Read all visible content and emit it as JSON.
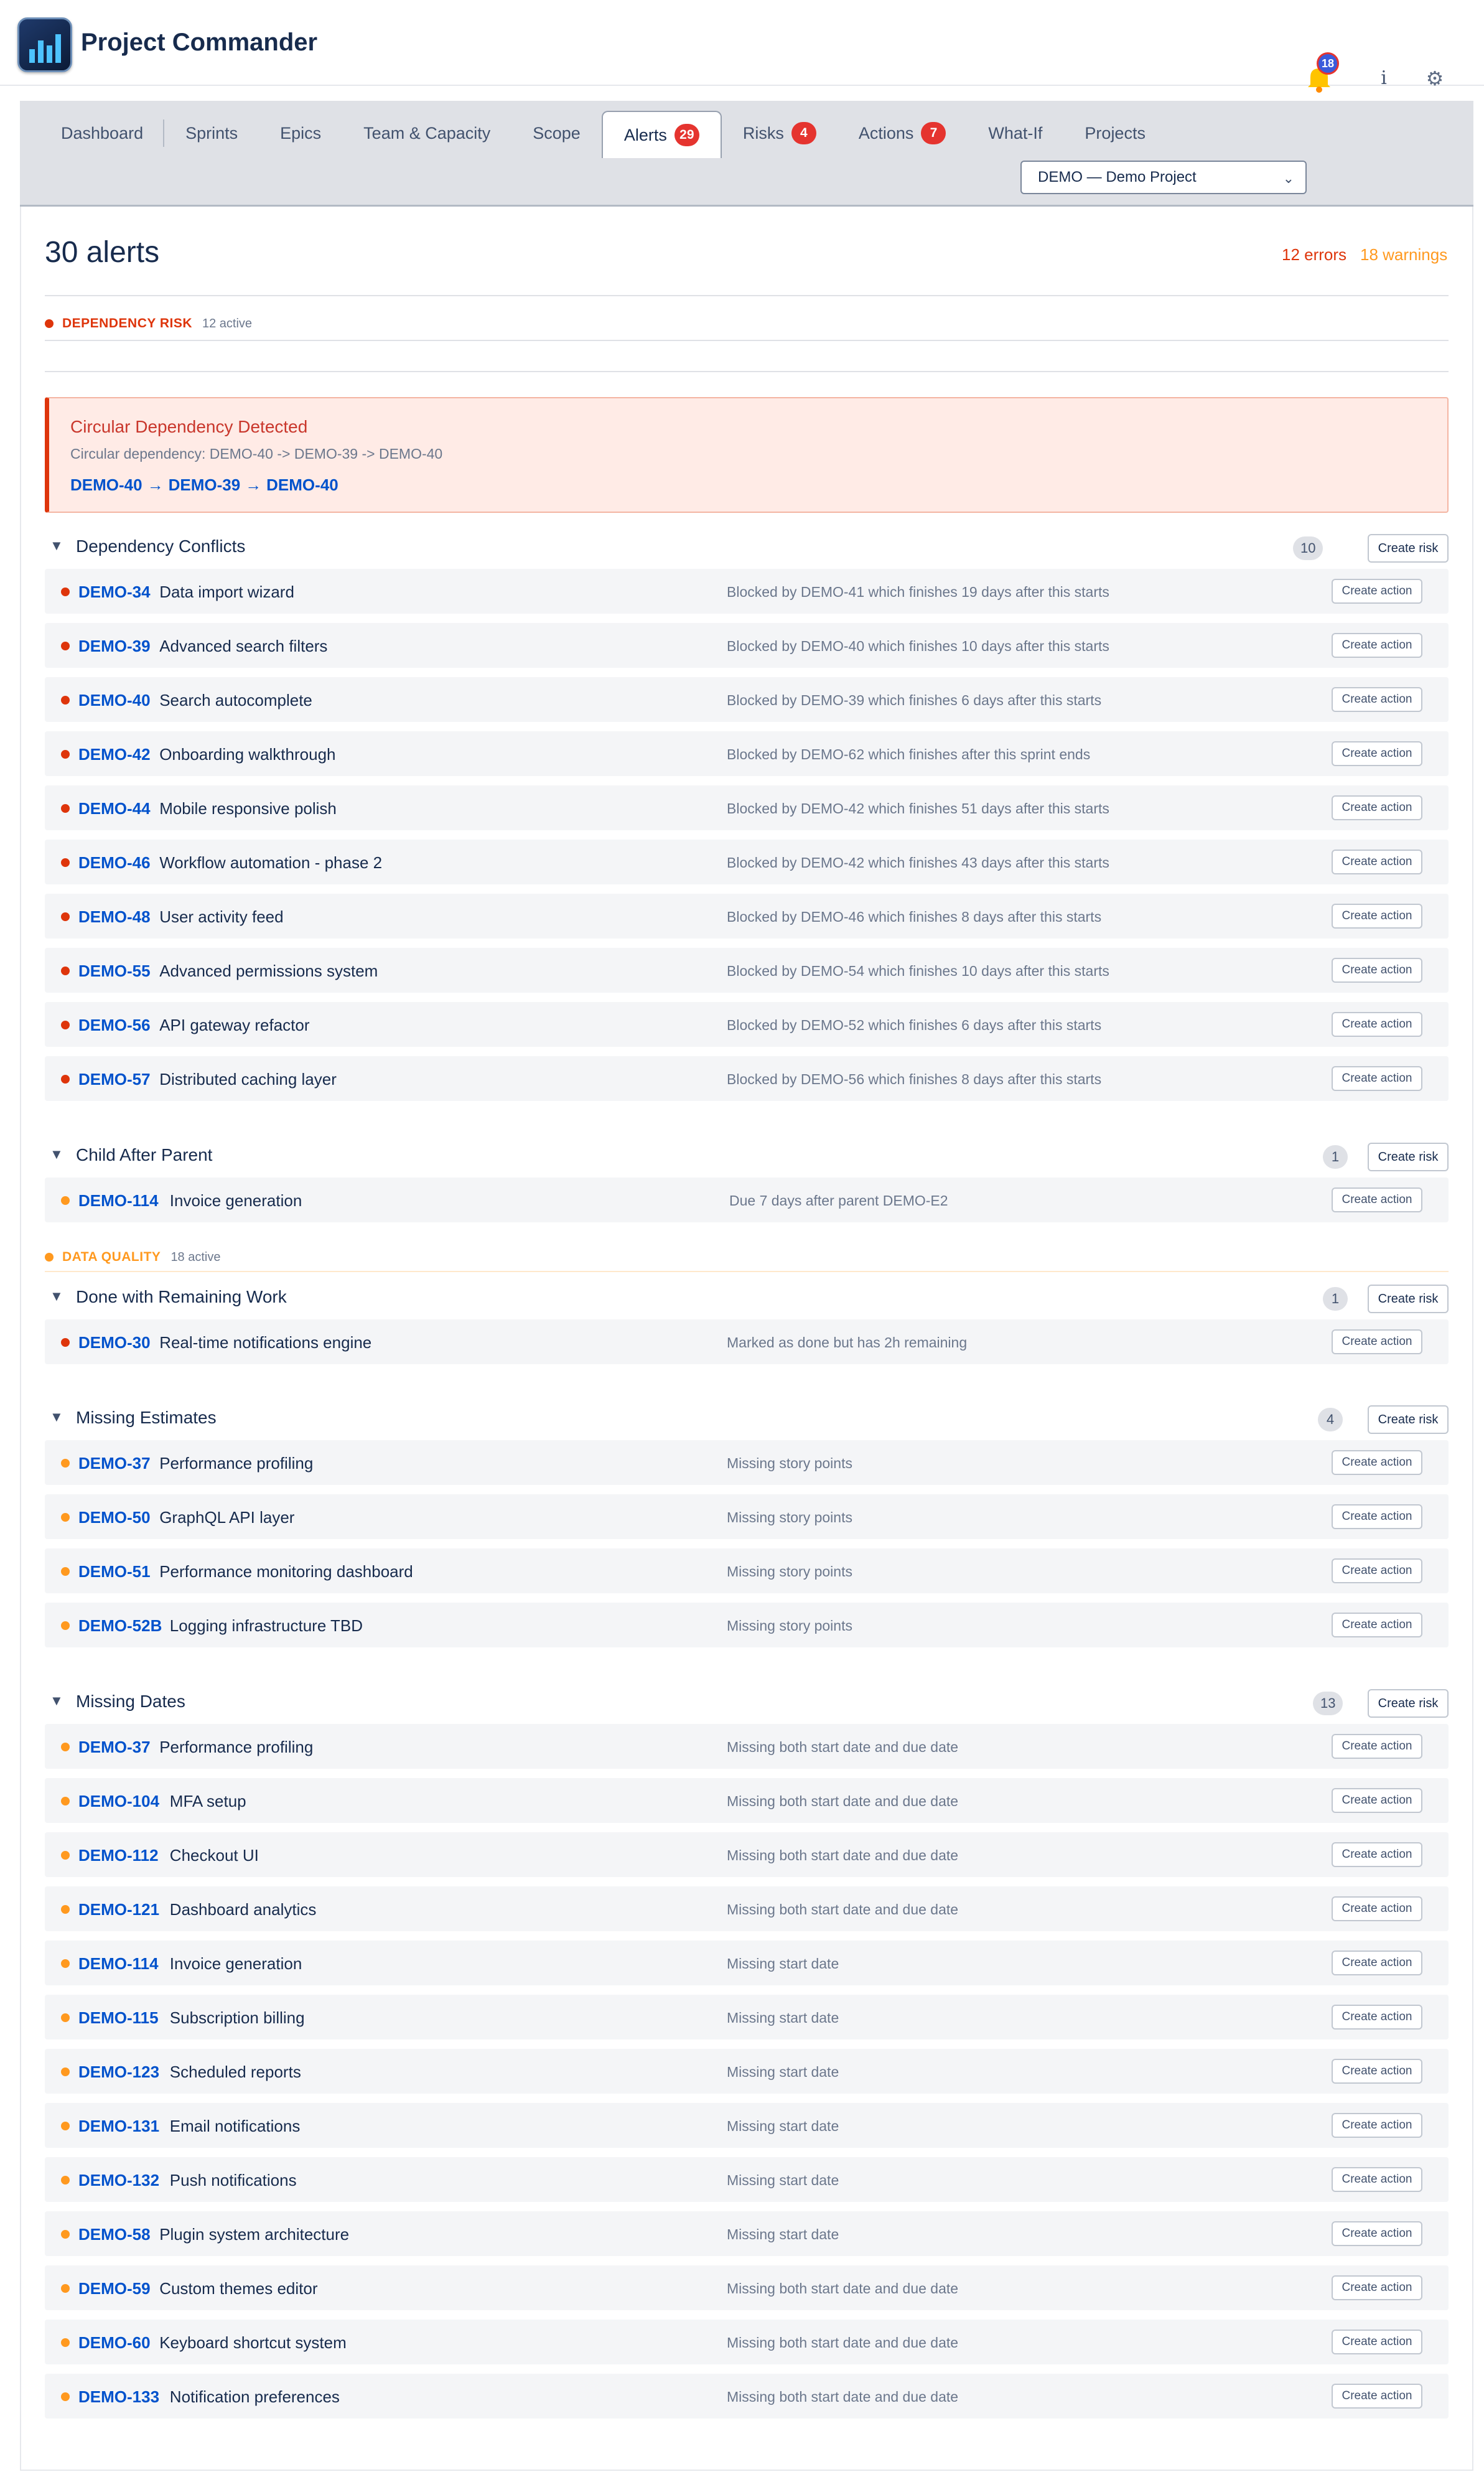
{
  "app": {
    "title": "Project Commander"
  },
  "nav": {
    "tabs": [
      {
        "label": "Dashboard",
        "badge": null
      },
      {
        "label": "Sprints",
        "badge": null
      },
      {
        "label": "Epics",
        "badge": null
      },
      {
        "label": "Team & Capacity",
        "badge": null
      },
      {
        "label": "Scope",
        "badge": null
      },
      {
        "label": "Alerts",
        "badge": "29"
      },
      {
        "label": "Risks",
        "badge": "4"
      },
      {
        "label": "Actions",
        "badge": "7"
      },
      {
        "label": "What-If",
        "badge": null
      },
      {
        "label": "Projects",
        "badge": null
      }
    ],
    "active_tab": "Alerts",
    "project_select": "DEMO — Demo Project",
    "notifications_count": "18",
    "icons": {
      "bell": "bell-icon",
      "info": "info-icon",
      "settings": "gear-icon",
      "logo": "bar-chart-logo"
    }
  },
  "summary": {
    "title": "30 alerts",
    "errors": "12 errors",
    "warnings": "18 warnings"
  },
  "colors": {
    "error": "#de350b",
    "warning": "#ff991f",
    "link": "#0052cc"
  },
  "categories": {
    "dependency": {
      "label": "DEPENDENCY RISK",
      "active": "12 active"
    },
    "quality": {
      "label": "DATA QUALITY",
      "active": "18 active"
    }
  },
  "circular": {
    "title": "Circular Dependency Detected",
    "description": "Circular dependency: DEMO-40 -> DEMO-39 -> DEMO-40",
    "chain": [
      "DEMO-40",
      "DEMO-39",
      "DEMO-40"
    ],
    "arrow": "→"
  },
  "labels": {
    "create_risk": "Create risk",
    "create_action": "Create action",
    "caret": "▼"
  },
  "groups": {
    "conflicts": {
      "title": "Dependency Conflicts",
      "count": "10",
      "rows": [
        {
          "key": "DEMO-34",
          "summary": "Data import wizard",
          "reason": "Blocked by DEMO-41 which finishes 19 days after this starts",
          "severity": "error"
        },
        {
          "key": "DEMO-39",
          "summary": "Advanced search filters",
          "reason": "Blocked by DEMO-40 which finishes 10 days after this starts",
          "severity": "error"
        },
        {
          "key": "DEMO-40",
          "summary": "Search autocomplete",
          "reason": "Blocked by DEMO-39 which finishes 6 days after this starts",
          "severity": "error"
        },
        {
          "key": "DEMO-42",
          "summary": "Onboarding walkthrough",
          "reason": "Blocked by DEMO-62 which finishes after this sprint ends",
          "severity": "error"
        },
        {
          "key": "DEMO-44",
          "summary": "Mobile responsive polish",
          "reason": "Blocked by DEMO-42 which finishes 51 days after this starts",
          "severity": "error"
        },
        {
          "key": "DEMO-46",
          "summary": "Workflow automation - phase 2",
          "reason": "Blocked by DEMO-42 which finishes 43 days after this starts",
          "severity": "error"
        },
        {
          "key": "DEMO-48",
          "summary": "User activity feed",
          "reason": "Blocked by DEMO-46 which finishes 8 days after this starts",
          "severity": "error"
        },
        {
          "key": "DEMO-55",
          "summary": "Advanced permissions system",
          "reason": "Blocked by DEMO-54 which finishes 10 days after this starts",
          "severity": "error"
        },
        {
          "key": "DEMO-56",
          "summary": "API gateway refactor",
          "reason": "Blocked by DEMO-52 which finishes 6 days after this starts",
          "severity": "error"
        },
        {
          "key": "DEMO-57",
          "summary": "Distributed caching layer",
          "reason": "Blocked by DEMO-56 which finishes 8 days after this starts",
          "severity": "error"
        }
      ]
    },
    "child": {
      "title": "Child After Parent",
      "count": "1",
      "rows": [
        {
          "key": "DEMO-114",
          "summary": "Invoice generation",
          "reason": "Due 7 days after parent DEMO-E2",
          "severity": "warning"
        }
      ]
    },
    "done": {
      "title": "Done with Remaining Work",
      "count": "1",
      "rows": [
        {
          "key": "DEMO-30",
          "summary": "Real-time notifications engine",
          "reason": "Marked as done but has 2h remaining",
          "severity": "error"
        }
      ]
    },
    "estimates": {
      "title": "Missing Estimates",
      "count": "4",
      "rows": [
        {
          "key": "DEMO-37",
          "summary": "Performance profiling",
          "reason": "Missing story points",
          "severity": "warning"
        },
        {
          "key": "DEMO-50",
          "summary": "GraphQL API layer",
          "reason": "Missing story points",
          "severity": "warning"
        },
        {
          "key": "DEMO-51",
          "summary": "Performance monitoring dashboard",
          "reason": "Missing story points",
          "severity": "warning"
        },
        {
          "key": "DEMO-52B",
          "summary": "Logging infrastructure TBD",
          "reason": "Missing story points",
          "severity": "warning"
        }
      ]
    },
    "dates": {
      "title": "Missing Dates",
      "count": "13",
      "rows": [
        {
          "key": "DEMO-37",
          "summary": "Performance profiling",
          "reason": "Missing both start date and due date",
          "severity": "warning"
        },
        {
          "key": "DEMO-104",
          "summary": "MFA setup",
          "reason": "Missing both start date and due date",
          "severity": "warning"
        },
        {
          "key": "DEMO-112",
          "summary": "Checkout UI",
          "reason": "Missing both start date and due date",
          "severity": "warning"
        },
        {
          "key": "DEMO-121",
          "summary": "Dashboard analytics",
          "reason": "Missing both start date and due date",
          "severity": "warning"
        },
        {
          "key": "DEMO-114",
          "summary": "Invoice generation",
          "reason": "Missing start date",
          "severity": "warning"
        },
        {
          "key": "DEMO-115",
          "summary": "Subscription billing",
          "reason": "Missing start date",
          "severity": "warning"
        },
        {
          "key": "DEMO-123",
          "summary": "Scheduled reports",
          "reason": "Missing start date",
          "severity": "warning"
        },
        {
          "key": "DEMO-131",
          "summary": "Email notifications",
          "reason": "Missing start date",
          "severity": "warning"
        },
        {
          "key": "DEMO-132",
          "summary": "Push notifications",
          "reason": "Missing start date",
          "severity": "warning"
        },
        {
          "key": "DEMO-58",
          "summary": "Plugin system architecture",
          "reason": "Missing start date",
          "severity": "warning"
        },
        {
          "key": "DEMO-59",
          "summary": "Custom themes editor",
          "reason": "Missing both start date and due date",
          "severity": "warning"
        },
        {
          "key": "DEMO-60",
          "summary": "Keyboard shortcut system",
          "reason": "Missing both start date and due date",
          "severity": "warning"
        },
        {
          "key": "DEMO-133",
          "summary": "Notification preferences",
          "reason": "Missing both start date and due date",
          "severity": "warning"
        }
      ]
    }
  }
}
